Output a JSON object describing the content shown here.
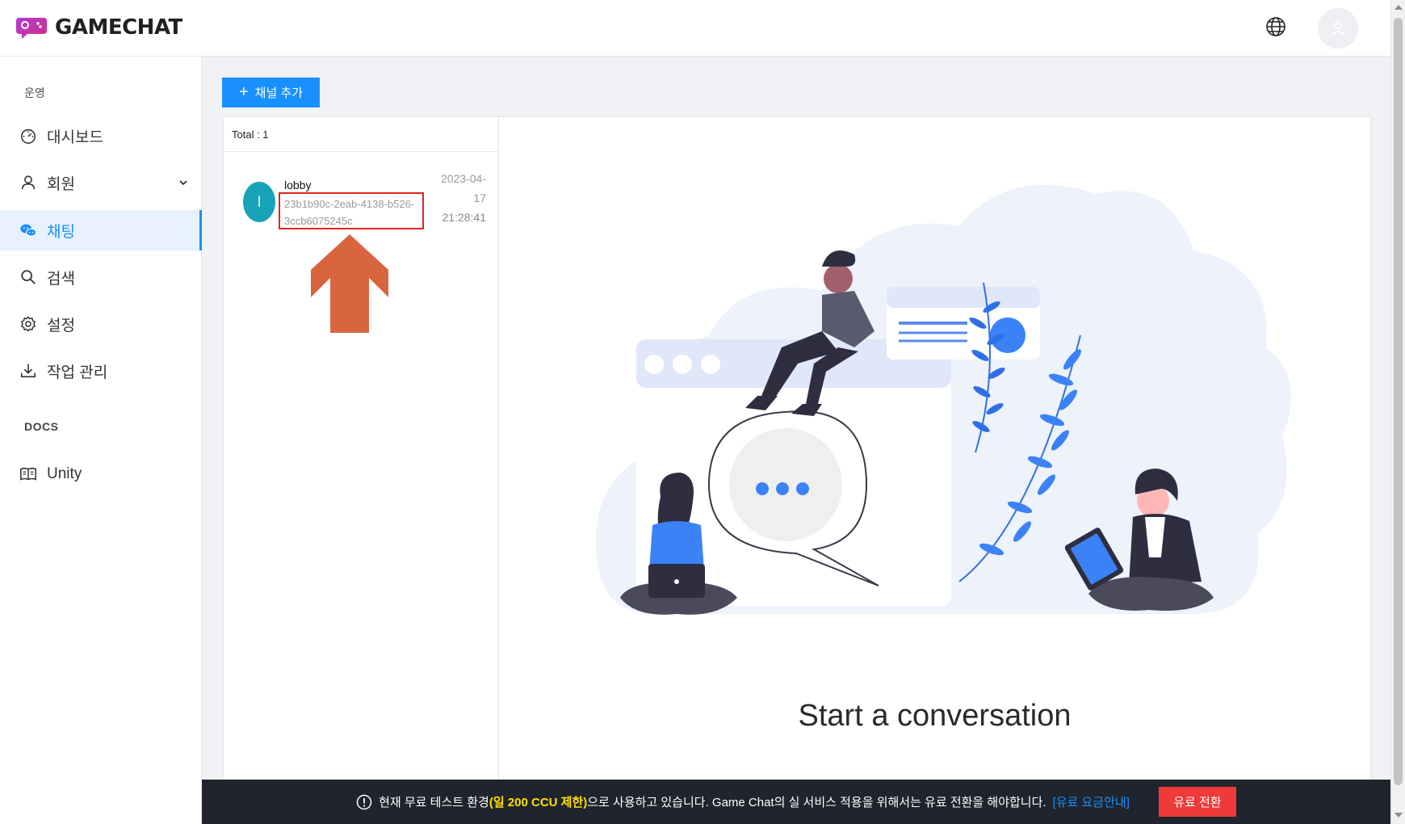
{
  "app": {
    "name": "GAMECHAT"
  },
  "header": {
    "globe_icon": "globe-icon",
    "avatar_icon": "user-icon"
  },
  "sidebar": {
    "sections": [
      {
        "title": "운영"
      },
      {
        "title": "DOCS"
      }
    ],
    "items": [
      {
        "label": "대시보드",
        "icon": "dashboard-icon"
      },
      {
        "label": "회원",
        "icon": "user-icon",
        "expandable": true
      },
      {
        "label": "채팅",
        "icon": "chat-icon",
        "active": true
      },
      {
        "label": "검색",
        "icon": "search-icon"
      },
      {
        "label": "설정",
        "icon": "gear-icon"
      },
      {
        "label": "작업 관리",
        "icon": "download-icon"
      },
      {
        "label": "Unity",
        "icon": "book-icon"
      }
    ]
  },
  "toolbar": {
    "add_channel_label": "채널 추가"
  },
  "channel_list": {
    "total_label": "Total : 1",
    "channels": [
      {
        "avatar_letter": "l",
        "name": "lobby",
        "id": "23b1b90c-2eab-4138-b526-3ccb6075245c",
        "date_line1": "2023-04-",
        "date_line2": "17",
        "time": "21:28:41"
      }
    ]
  },
  "chat": {
    "empty_text": "Start a conversation"
  },
  "banner": {
    "text_before": "현재 무료 테스트 환경",
    "highlight": "(일 200 CCU 제한)",
    "text_after": "으로 사용하고 있습니다. Game Chat의 실 서비스 적용을 위해서는 유료 전환을 해야합니다.",
    "link": "[유료 요금안내]",
    "button": "유료 전환"
  },
  "colors": {
    "accent": "#1890ff",
    "danger": "#ef3a3a",
    "banner_bg": "#20242c",
    "highlight": "#ffe100",
    "channel_avatar": "#17a2b8",
    "annotation_red": "#e0251b",
    "annotation_arrow": "#d9653f"
  }
}
